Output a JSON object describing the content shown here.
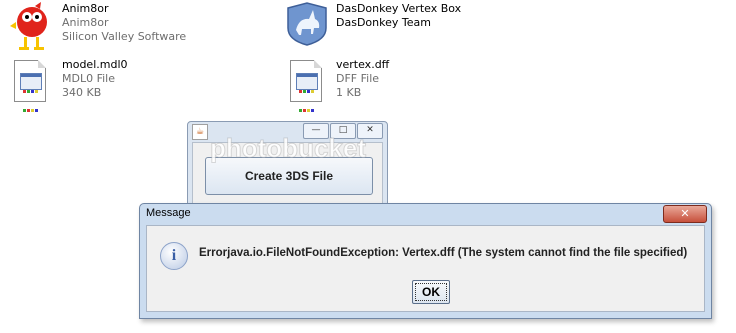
{
  "desktop": {
    "files": [
      {
        "name": "Anim8or",
        "line2": "Anim8or",
        "line3": "Silicon Valley Software",
        "icon": "anim8or-bird-icon"
      },
      {
        "name": "DasDonkey Vertex Box",
        "line2": "DasDonkey Team",
        "line3": "",
        "icon": "donkey-shield-icon"
      },
      {
        "name": "model.mdl0",
        "line2": "MDL0 File",
        "line3": "340 KB",
        "icon": "document-icon"
      },
      {
        "name": "vertex.dff",
        "line2": "DFF File",
        "line3": "1 KB",
        "icon": "document-icon"
      }
    ]
  },
  "app_window": {
    "title_icon": "java-cup-icon",
    "caption_buttons": {
      "minimize": "—",
      "maximize": "□",
      "close": "✕"
    },
    "button_label": "Create 3DS File"
  },
  "watermark": {
    "text": "photobucket"
  },
  "message_dialog": {
    "title": "Message",
    "close_label": "✕",
    "icon": "info-icon",
    "icon_glyph": "i",
    "message": "Errorjava.io.FileNotFoundException: Vertex.dff (The system cannot find the file specified)",
    "ok_label": "OK"
  },
  "colors": {
    "dialog_frame": "#cbdcef",
    "close_button": "#c7503b",
    "client_background": "#f0f0f0"
  }
}
